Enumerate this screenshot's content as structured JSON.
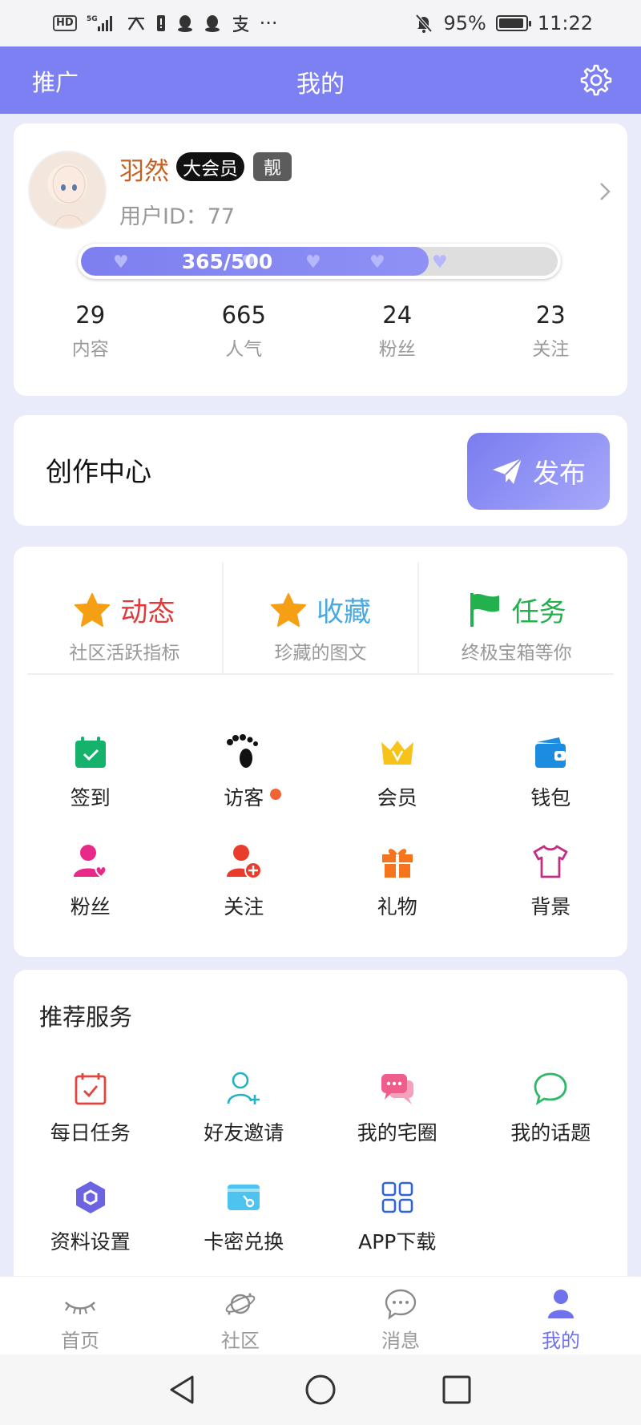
{
  "status_bar": {
    "network_badge": "HD",
    "network_gen": "5G",
    "battery_percent": 95,
    "battery_text": "95%",
    "time": "11:22",
    "more": "···"
  },
  "header": {
    "left_tab": "推广",
    "title": "我的"
  },
  "profile": {
    "username": "羽然",
    "vip_badge": "大会员",
    "tag_badge": "靓",
    "user_id": "用户ID：77",
    "exp_current": 365,
    "exp_total": 500,
    "exp_text": "365/500",
    "stats": [
      {
        "value": "29",
        "label": "内容"
      },
      {
        "value": "665",
        "label": "人气"
      },
      {
        "value": "24",
        "label": "粉丝"
      },
      {
        "value": "23",
        "label": "关注"
      }
    ]
  },
  "creation": {
    "label": "创作中心",
    "publish_button": "发布"
  },
  "features": [
    {
      "label": "动态",
      "sub": "社区活跃指标",
      "color": "#e03a3a",
      "icon": "star-icon"
    },
    {
      "label": "收藏",
      "sub": "珍藏的图文",
      "color": "#4aa9df",
      "icon": "star-icon"
    },
    {
      "label": "任务",
      "sub": "终极宝箱等你",
      "color": "#22b14c",
      "icon": "flag-icon"
    }
  ],
  "shortcuts": [
    {
      "label": "签到",
      "icon": "calendar-check-icon"
    },
    {
      "label": "访客",
      "icon": "footprint-icon"
    },
    {
      "label": "会员",
      "icon": "crown-icon"
    },
    {
      "label": "钱包",
      "icon": "wallet-icon"
    },
    {
      "label": "粉丝",
      "icon": "user-heart-icon"
    },
    {
      "label": "关注",
      "icon": "user-add-icon"
    },
    {
      "label": "礼物",
      "icon": "gift-icon"
    },
    {
      "label": "背景",
      "icon": "tshirt-icon"
    }
  ],
  "services": {
    "heading": "推荐服务",
    "items": [
      {
        "label": "每日任务",
        "icon": "calendar-task-icon"
      },
      {
        "label": "好友邀请",
        "icon": "invite-user-icon"
      },
      {
        "label": "我的宅圈",
        "icon": "chat-bubbles-icon"
      },
      {
        "label": "我的话题",
        "icon": "speech-bubble-icon"
      },
      {
        "label": "资料设置",
        "icon": "hexagon-settings-icon"
      },
      {
        "label": "卡密兑换",
        "icon": "card-key-icon"
      },
      {
        "label": "APP下载",
        "icon": "apps-grid-icon"
      }
    ]
  },
  "bottom_nav": [
    {
      "label": "首页",
      "icon": "eye-lashes-icon",
      "active": false
    },
    {
      "label": "社区",
      "icon": "planet-icon",
      "active": false
    },
    {
      "label": "消息",
      "icon": "message-icon",
      "active": false
    },
    {
      "label": "我的",
      "icon": "person-icon",
      "active": true
    }
  ],
  "colors": {
    "accent": "#7d80f2",
    "active_nav": "#6f72ec",
    "username": "#c46225"
  }
}
